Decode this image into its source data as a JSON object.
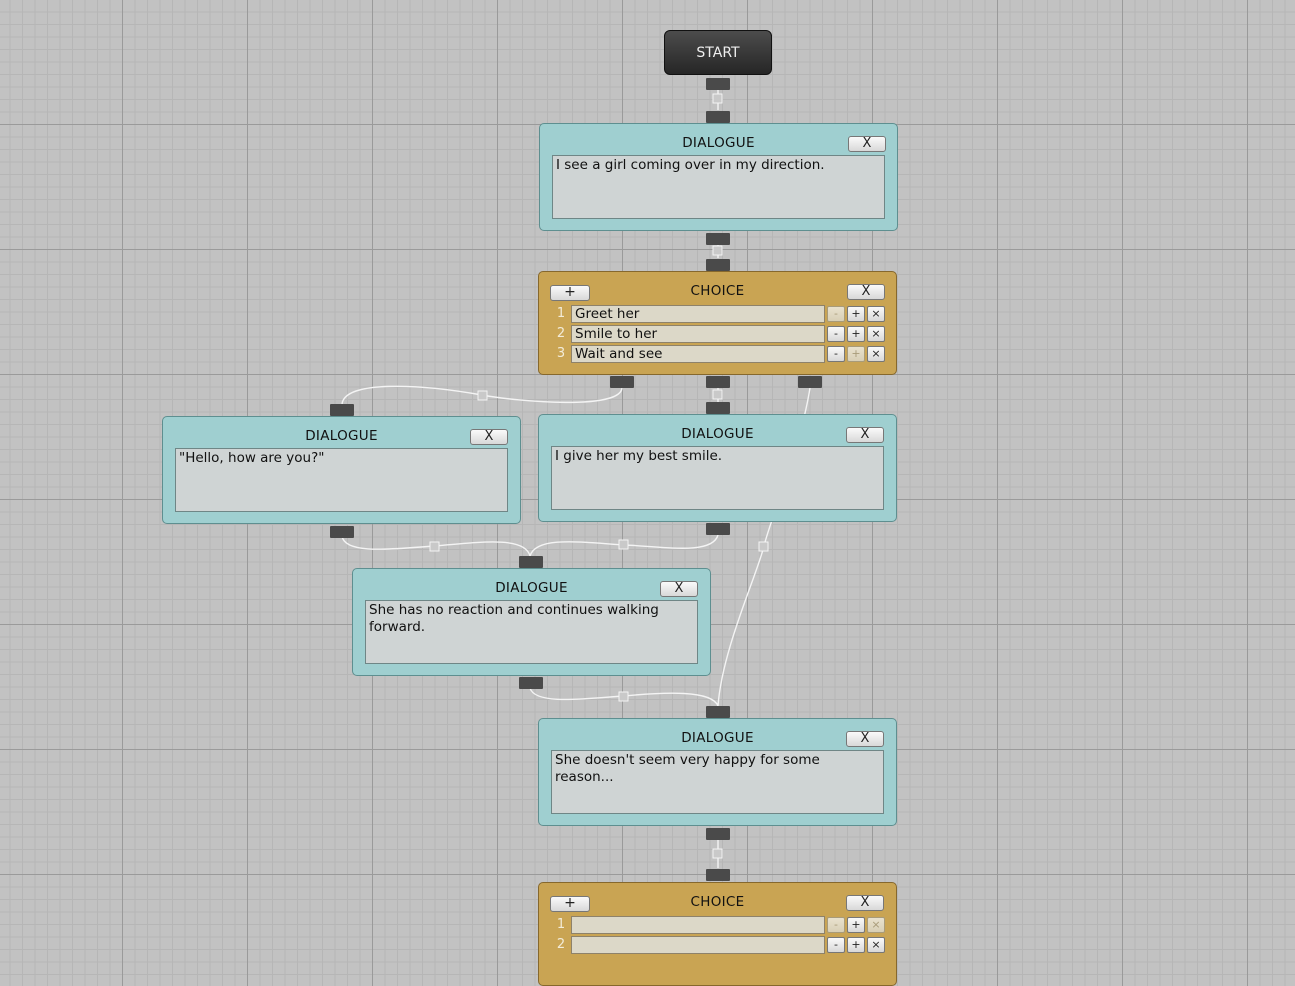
{
  "start": {
    "label": "START"
  },
  "dialogue_title": "DIALOGUE",
  "choice_title": "CHOICE",
  "close_label": "X",
  "add_label": "+",
  "row_buttons": {
    "minus": "-",
    "plus": "+",
    "delete": "×"
  },
  "dialogue1": {
    "text": "I see a girl coming over in my direction."
  },
  "choice1": {
    "options": [
      {
        "num": "1",
        "text": "Greet her"
      },
      {
        "num": "2",
        "text": "Smile to her"
      },
      {
        "num": "3",
        "text": "Wait and see"
      }
    ]
  },
  "dialogue2": {
    "text": "\"Hello, how are you?\""
  },
  "dialogue3": {
    "text": "I give her my best smile."
  },
  "dialogue4": {
    "text": "She has no reaction and continues walking forward."
  },
  "dialogue5": {
    "text": "She doesn't seem very happy for some reason..."
  },
  "choice2": {
    "options": [
      {
        "num": "1",
        "text": ""
      },
      {
        "num": "2",
        "text": ""
      }
    ]
  }
}
